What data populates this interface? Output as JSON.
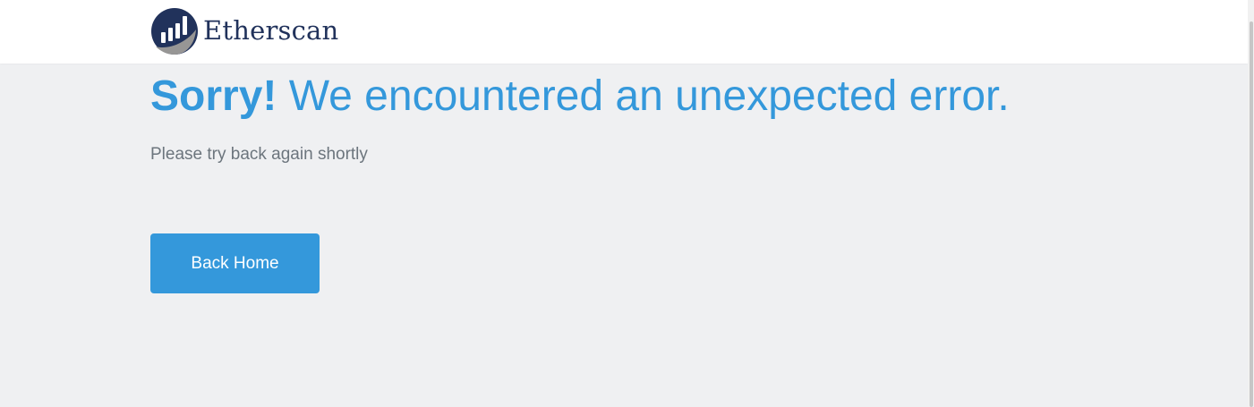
{
  "header": {
    "brand_name": "Etherscan"
  },
  "error": {
    "title_strong": "Sorry!",
    "title_rest": " We encountered an unexpected error.",
    "subtitle": "Please try back again shortly"
  },
  "actions": {
    "back_home_label": "Back Home"
  },
  "colors": {
    "accent": "#3498db",
    "brand_dark": "#21325b",
    "background": "#eff0f2",
    "muted_text": "#6c757d"
  },
  "icons": {
    "logo": "etherscan-logo-icon"
  }
}
